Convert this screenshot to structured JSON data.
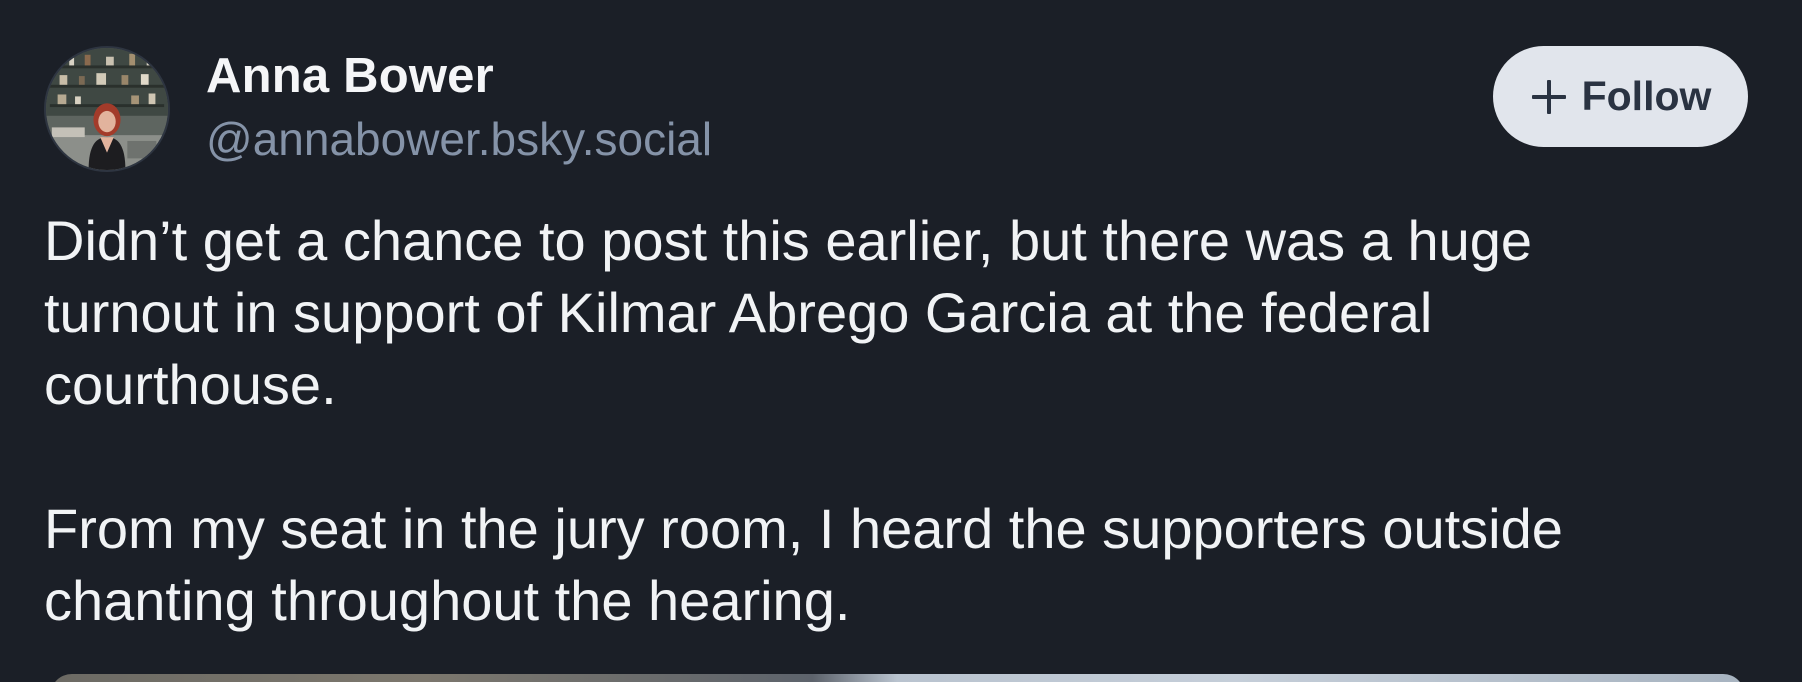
{
  "author": {
    "display_name": "Anna Bower",
    "handle": "@annabower.bsky.social",
    "avatar_icon": "profile-photo"
  },
  "follow_button": {
    "label": "Follow",
    "icon": "plus-icon",
    "background": "#e1e5ec"
  },
  "post": {
    "paragraph_1": [
      "Didn’t get a chance to post this earlier, but there was a huge",
      "turnout in support of Kilmar Abrego Garcia at the federal",
      "courthouse."
    ],
    "paragraph_2": [
      "From my seat in the jury room, I heard the supporters outside",
      "chanting throughout the hearing."
    ]
  },
  "colors": {
    "background": "#1b1f27",
    "text": "#f1f3f5",
    "handle": "#8593a8"
  }
}
